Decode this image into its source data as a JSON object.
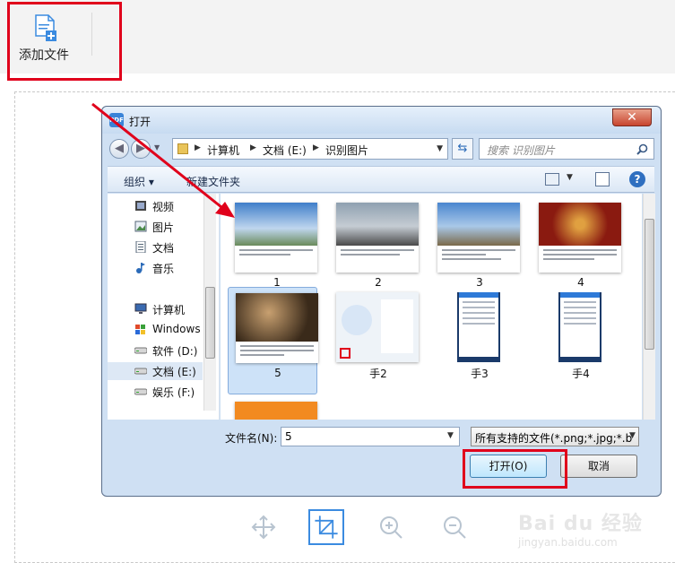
{
  "toolbar": {
    "add_file_label": "添加文件"
  },
  "dialog": {
    "title": "打开",
    "close_symbol": "✕",
    "breadcrumb": [
      "计算机",
      "文档 (E:)",
      "识别图片"
    ],
    "search_placeholder": "搜索 识别图片",
    "organize_label": "组织 ▾",
    "new_folder_label": "新建文件夹",
    "help_symbol": "?",
    "nav_items": [
      {
        "label": "视频",
        "icon": "video-icon"
      },
      {
        "label": "图片",
        "icon": "pictures-icon"
      },
      {
        "label": "文档",
        "icon": "documents-icon"
      },
      {
        "label": "音乐",
        "icon": "music-icon"
      },
      {
        "label": "计算机",
        "icon": "computer-icon"
      },
      {
        "label": "Windows",
        "icon": "windows-drive-icon"
      },
      {
        "label": "软件 (D:)",
        "icon": "drive-icon"
      },
      {
        "label": "文档 (E:)",
        "icon": "drive-icon"
      },
      {
        "label": "娱乐 (F:)",
        "icon": "drive-icon"
      }
    ],
    "files": [
      {
        "name": "1"
      },
      {
        "name": "2"
      },
      {
        "name": "3"
      },
      {
        "name": "4"
      },
      {
        "name": "5"
      },
      {
        "name": "手2"
      },
      {
        "name": "手3"
      },
      {
        "name": "手4"
      }
    ],
    "selected_file": "5",
    "filename_label": "文件名(N):",
    "filename_value": "5",
    "filetype_value": "所有支持的文件(*.png;*.jpg;*.b",
    "open_label": "打开(O)",
    "cancel_label": "取消"
  },
  "watermark": {
    "text": "Bai du 经验",
    "url": "jingyan.baidu.com"
  },
  "colors": {
    "highlight_red": "#e0001b",
    "accent_blue": "#3b8be0"
  }
}
